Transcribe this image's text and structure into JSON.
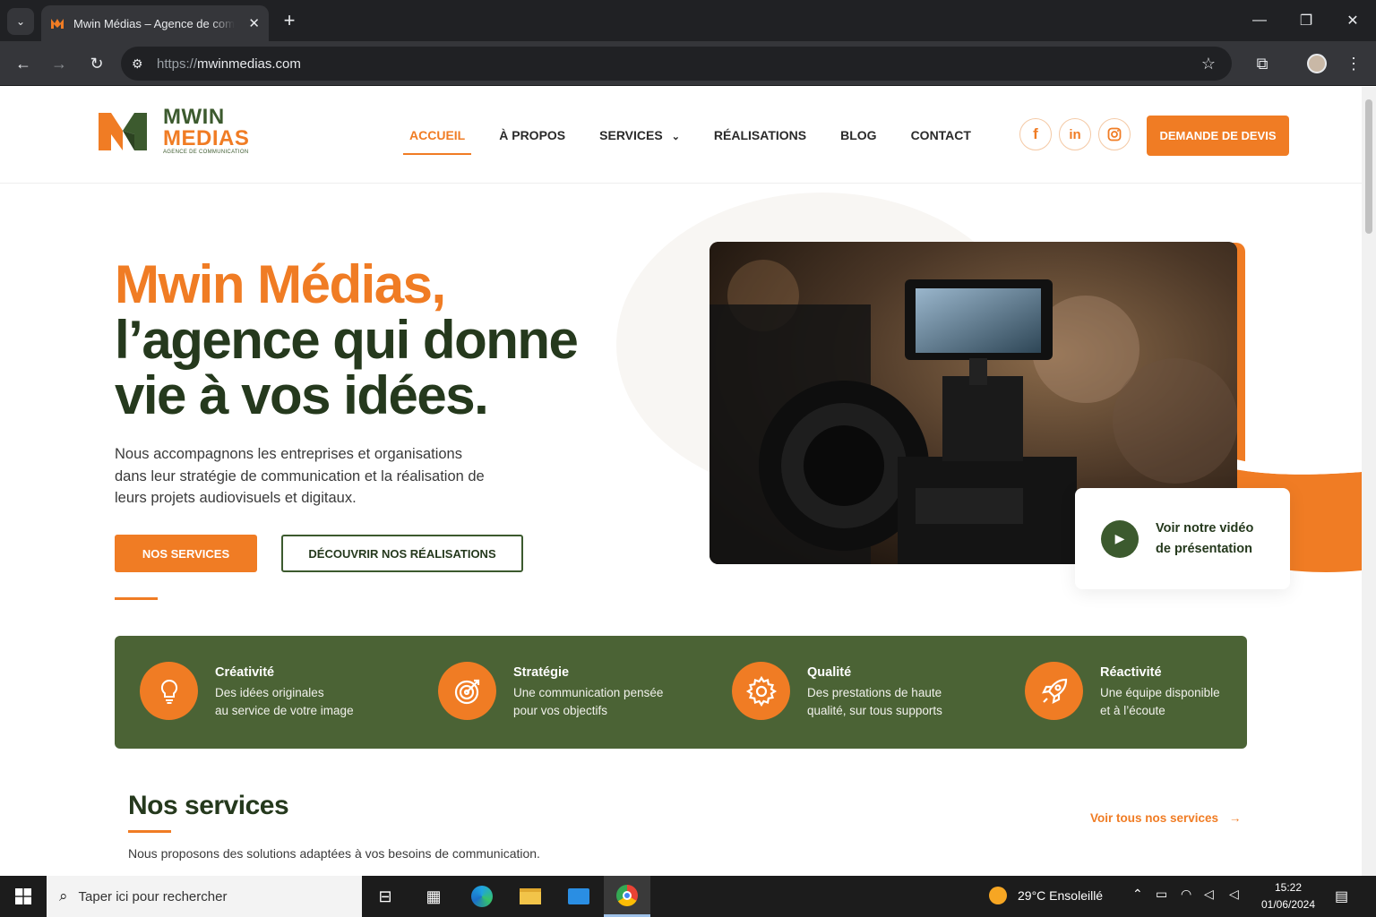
{
  "browser": {
    "tab_title": "Mwin Médias – Agence de communication",
    "url_protocol": "https://",
    "url_host": "mwinmedias.com"
  },
  "site": {
    "logo": {
      "line1": "MWIN",
      "line2": "MEDIAS",
      "tagline": "AGENCE DE COMMUNICATION"
    },
    "nav": [
      {
        "label": "ACCUEIL"
      },
      {
        "label": "À PROPOS"
      },
      {
        "label": "SERVICES"
      },
      {
        "label": "RÉALISATIONS"
      },
      {
        "label": "BLOG"
      },
      {
        "label": "CONTACT"
      }
    ],
    "social": [
      {
        "icon": "facebook-icon",
        "glyph": "f"
      },
      {
        "icon": "linkedin-icon",
        "glyph": "in"
      },
      {
        "icon": "instagram-icon",
        "glyph": "◎"
      }
    ],
    "cta_label": "DEMANDE DE DEVIS"
  },
  "hero": {
    "title_line1": "Mwin Médias,",
    "title_line2": "l’agence qui donne",
    "title_line3": "vie à vos idées.",
    "paragraph": "Nous accompagnons les entreprises et organisations dans leur stratégie de communication et la réalisation de leurs projets audiovisuels et digitaux.",
    "btn_services": "NOS SERVICES",
    "btn_realisations": "DÉCOUVRIR NOS RÉALISATIONS",
    "video_card": "Voir notre vidéo de présentation"
  },
  "values": [
    {
      "title": "Créativité",
      "line1": "Des idées originales",
      "line2": "au service de votre image",
      "icon": "lightbulb-icon"
    },
    {
      "title": "Stratégie",
      "line1": "Une communication pensée",
      "line2": "pour vos objectifs",
      "icon": "target-icon"
    },
    {
      "title": "Qualité",
      "line1": "Des prestations de haute",
      "line2": "qualité, sur tous supports",
      "icon": "gear-icon"
    },
    {
      "title": "Réactivité",
      "line1": "Une équipe disponible",
      "line2": "et à l’écoute",
      "icon": "rocket-icon"
    }
  ],
  "services": {
    "title": "Nos services",
    "subtitle": "Nous proposons des solutions adaptées à vos besoins de communication.",
    "link": "Voir tous nos services"
  },
  "taskbar": {
    "search_placeholder": "Taper ici pour rechercher",
    "weather": "29°C  Ensoleillé",
    "time": "15:22",
    "date": "01/06/2024"
  },
  "colors": {
    "accent": "#f07c24",
    "brand_green": "#3c5a2e",
    "dark_green": "#25391d",
    "band_green": "#4b6335"
  }
}
